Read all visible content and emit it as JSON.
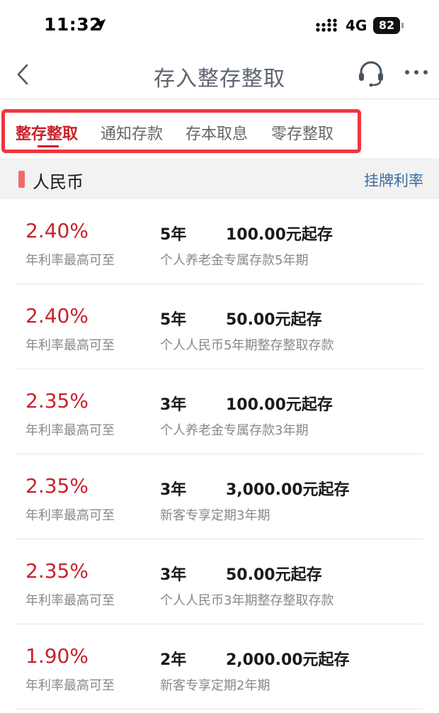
{
  "status_bar": {
    "time": "11:32",
    "network": "4G",
    "battery": "82"
  },
  "nav": {
    "title": "存入整存整取"
  },
  "tabs": [
    {
      "label": "整存整取",
      "active": true
    },
    {
      "label": "通知存款",
      "active": false
    },
    {
      "label": "存本取息",
      "active": false
    },
    {
      "label": "零存整取",
      "active": false
    }
  ],
  "section": {
    "currency": "人民币",
    "rate_link": "挂牌利率"
  },
  "products": [
    {
      "rate": "2.40%",
      "rate_label": "年利率最高可至",
      "term": "5年",
      "min_amount": "100.00元起存",
      "name": "个人养老金专属存款5年期"
    },
    {
      "rate": "2.40%",
      "rate_label": "年利率最高可至",
      "term": "5年",
      "min_amount": "50.00元起存",
      "name": "个人人民币5年期整存整取存款"
    },
    {
      "rate": "2.35%",
      "rate_label": "年利率最高可至",
      "term": "3年",
      "min_amount": "100.00元起存",
      "name": "个人养老金专属存款3年期"
    },
    {
      "rate": "2.35%",
      "rate_label": "年利率最高可至",
      "term": "3年",
      "min_amount": "3,000.00元起存",
      "name": "新客专享定期3年期"
    },
    {
      "rate": "2.35%",
      "rate_label": "年利率最高可至",
      "term": "3年",
      "min_amount": "50.00元起存",
      "name": "个人人民币3年期整存整取存款"
    },
    {
      "rate": "1.90%",
      "rate_label": "年利率最高可至",
      "term": "2年",
      "min_amount": "2,000.00元起存",
      "name": "新客专享定期2年期"
    }
  ],
  "colors": {
    "accent_red": "#c8222c",
    "highlight_border": "#ef3640",
    "link_blue": "#3c6c9b"
  },
  "icons": {
    "location": "location-arrow-icon",
    "signal": "signal-bars-icon",
    "battery": "battery-icon",
    "back": "chevron-left-icon",
    "support": "headset-icon",
    "more": "more-dots-icon"
  }
}
